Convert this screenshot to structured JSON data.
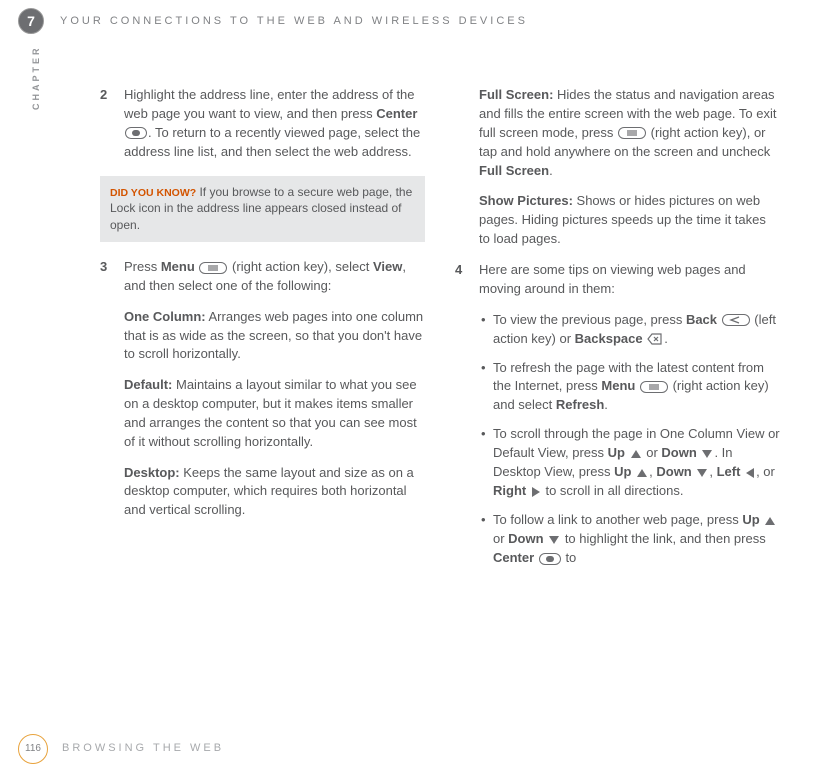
{
  "header": {
    "chapter_number": "7",
    "chapter_label": "CHAPTER",
    "title": "YOUR CONNECTIONS TO THE WEB AND WIRELESS DEVICES"
  },
  "footer": {
    "page_number": "116",
    "section": "BROWSING THE WEB"
  },
  "left": {
    "step2": {
      "num": "2",
      "t1": "Highlight the address line, enter the address of the web page you want to view, and then press ",
      "b1": "Center",
      "t2": ". To return to a recently viewed page, select the address line list, and then select the web address."
    },
    "tip": {
      "label": "DID YOU KNOW?",
      "text": " If you browse to a secure web page, the Lock icon in the address line appears closed instead of open."
    },
    "step3": {
      "num": "3",
      "t1": "Press ",
      "b1": "Menu",
      "t2": " (right action key), select ",
      "b2": "View",
      "t3": ", and then select one of the following:"
    },
    "onecol": {
      "b": "One Column:",
      "t": " Arranges web pages into one column that is as wide as the screen, so that you don't have to scroll horizontally."
    },
    "default": {
      "b": "Default:",
      "t": " Maintains a layout similar to what you see on a desktop computer, but it makes items smaller and arranges the content so that you can see most of it without scrolling horizontally."
    },
    "desktop": {
      "b": "Desktop:",
      "t": " Keeps the same layout and size as on a desktop computer, which requires both horizontal and vertical scrolling."
    }
  },
  "right": {
    "fullscreen": {
      "b1": "Full Screen:",
      "t1": " Hides the status and navigation areas and fills the entire screen with the web page. To exit full screen mode, press ",
      "t2": " (right action key), or tap and hold anywhere on the screen and uncheck ",
      "b2": "Full Screen",
      "t3": "."
    },
    "showpics": {
      "b": "Show Pictures:",
      "t": " Shows or hides pictures on web pages. Hiding pictures speeds up the time it takes to load pages."
    },
    "step4": {
      "num": "4",
      "t": "Here are some tips on viewing web pages and moving around in them:"
    },
    "bul1": {
      "t1": "To view the previous page, press ",
      "b1": "Back",
      "t2": " (left action key) or ",
      "b2": "Backspace",
      "t3": "."
    },
    "bul2": {
      "t1": "To refresh the page with the latest content from the Internet, press ",
      "b1": "Menu",
      "t2": " (right action key) and select ",
      "b2": "Refresh",
      "t3": "."
    },
    "bul3": {
      "t1": "To scroll through the page in One Column View or Default View, press ",
      "b1": "Up",
      "t2": " or ",
      "b2": "Down",
      "t3": ". In Desktop View, press ",
      "b3": "Up",
      "t4": ", ",
      "b4": "Down",
      "t5": ", ",
      "b5": "Left",
      "t6": ", or ",
      "b6": "Right",
      "t7": " to scroll in all directions."
    },
    "bul4": {
      "t1": "To follow a link to another web page, press ",
      "b1": "Up",
      "t2": " or ",
      "b2": "Down",
      "t3": " to highlight the link, and then press ",
      "b3": "Center",
      "t4": " to"
    }
  }
}
